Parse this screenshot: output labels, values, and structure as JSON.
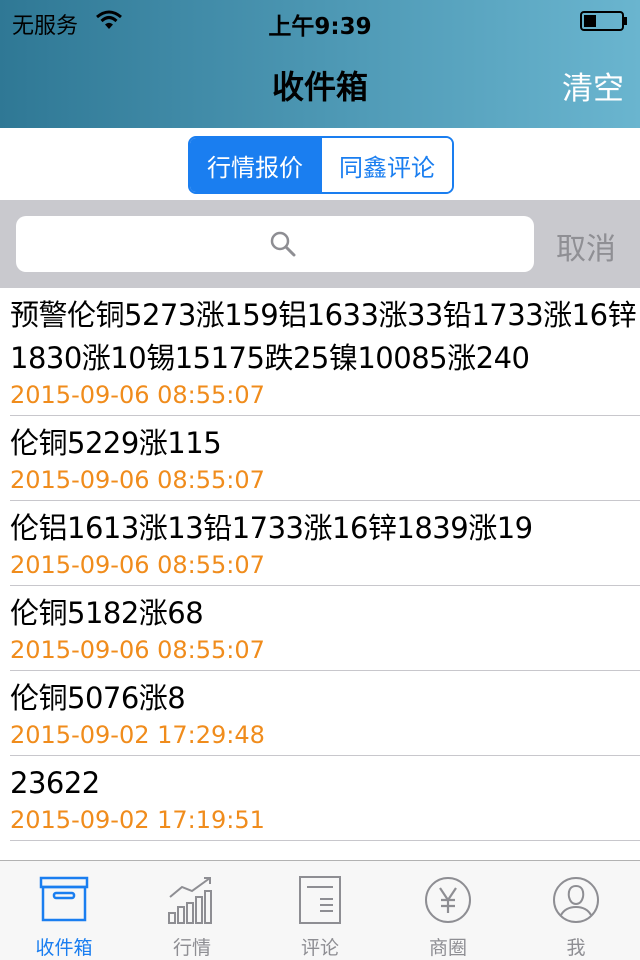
{
  "status_bar": {
    "carrier": "无服务",
    "time": "上午9:39"
  },
  "nav": {
    "title": "收件箱",
    "clear_label": "清空"
  },
  "segments": {
    "active": "行情报价",
    "inactive": "同鑫评论"
  },
  "search": {
    "placeholder": "",
    "cancel_label": "取消"
  },
  "messages": [
    {
      "text": "预警伦铜5273涨159铝1633涨33铅1733涨16锌1830涨10锡15175跌25镍10085涨240",
      "time": "2015-09-06 08:55:07"
    },
    {
      "text": "伦铜5229涨115",
      "time": "2015-09-06 08:55:07"
    },
    {
      "text": "伦铝1613涨13铅1733涨16锌1839涨19",
      "time": "2015-09-06 08:55:07"
    },
    {
      "text": "伦铜5182涨68",
      "time": "2015-09-06 08:55:07"
    },
    {
      "text": "伦铜5076涨8",
      "time": "2015-09-02 17:29:48"
    },
    {
      "text": "23622",
      "time": "2015-09-02 17:19:51"
    }
  ],
  "tabs": [
    {
      "label": "收件箱",
      "icon": "inbox-box-icon",
      "active": true
    },
    {
      "label": "行情",
      "icon": "market-chart-icon",
      "active": false
    },
    {
      "label": "评论",
      "icon": "document-icon",
      "active": false
    },
    {
      "label": "商圈",
      "icon": "yen-coin-icon",
      "active": false
    },
    {
      "label": "我",
      "icon": "person-icon",
      "active": false
    }
  ],
  "colors": {
    "accent": "#1a7ef0",
    "timestamp": "#f08c1c",
    "nav_gradient_start": "#2f7895",
    "nav_gradient_end": "#6ab5cf"
  }
}
